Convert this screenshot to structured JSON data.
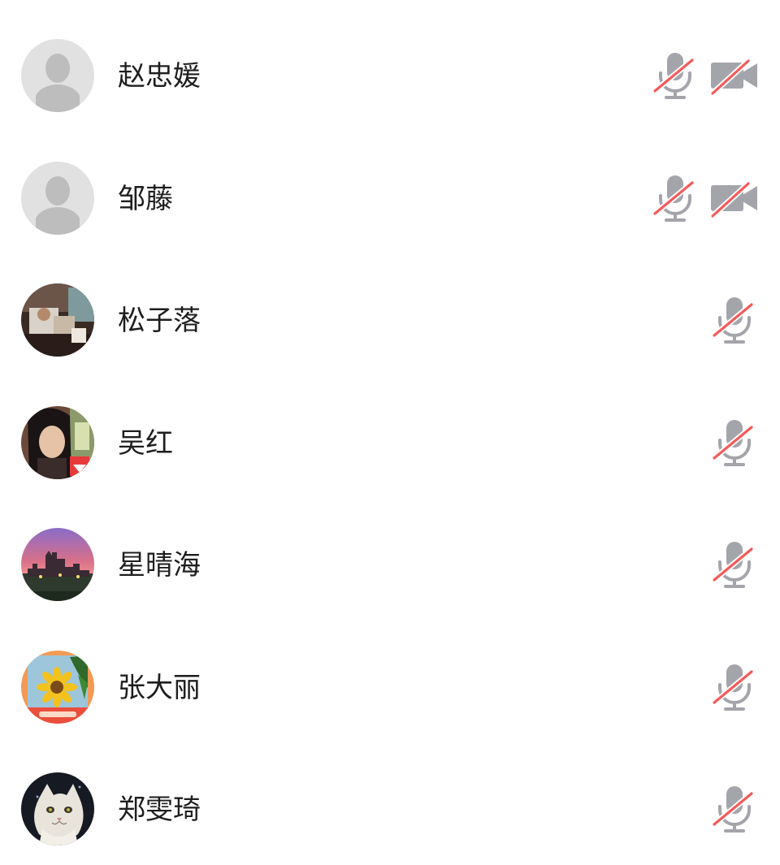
{
  "participants": [
    {
      "name": "赵忠媛",
      "avatar": "default-avatar",
      "mic_icon": "mic-muted-icon",
      "camera_icon": "camera-off-icon",
      "mic_muted": true,
      "camera_off": true
    },
    {
      "name": "邹藤",
      "avatar": "default-avatar",
      "mic_icon": "mic-muted-icon",
      "camera_icon": "camera-off-icon",
      "mic_muted": true,
      "camera_off": true
    },
    {
      "name": "松子落",
      "avatar": "photo-avatar-room",
      "mic_icon": "mic-muted-icon",
      "mic_muted": true
    },
    {
      "name": "吴红",
      "avatar": "photo-avatar-woman",
      "mic_icon": "mic-muted-icon",
      "mic_muted": true
    },
    {
      "name": "星晴海",
      "avatar": "photo-avatar-sunset-castle",
      "mic_icon": "mic-muted-icon",
      "mic_muted": true
    },
    {
      "name": "张大丽",
      "avatar": "photo-avatar-sunflower",
      "mic_icon": "mic-muted-icon",
      "mic_muted": true
    },
    {
      "name": "郑雯琦",
      "avatar": "photo-avatar-cat",
      "mic_icon": "mic-muted-icon",
      "mic_muted": true
    }
  ],
  "colors": {
    "icon_gray": "#a4a4ab",
    "slash_red": "#f45a5a",
    "name_text": "#1e1e1e",
    "default_avatar_bg": "#e1e1e1",
    "default_avatar_fg": "#bdbdbd"
  }
}
